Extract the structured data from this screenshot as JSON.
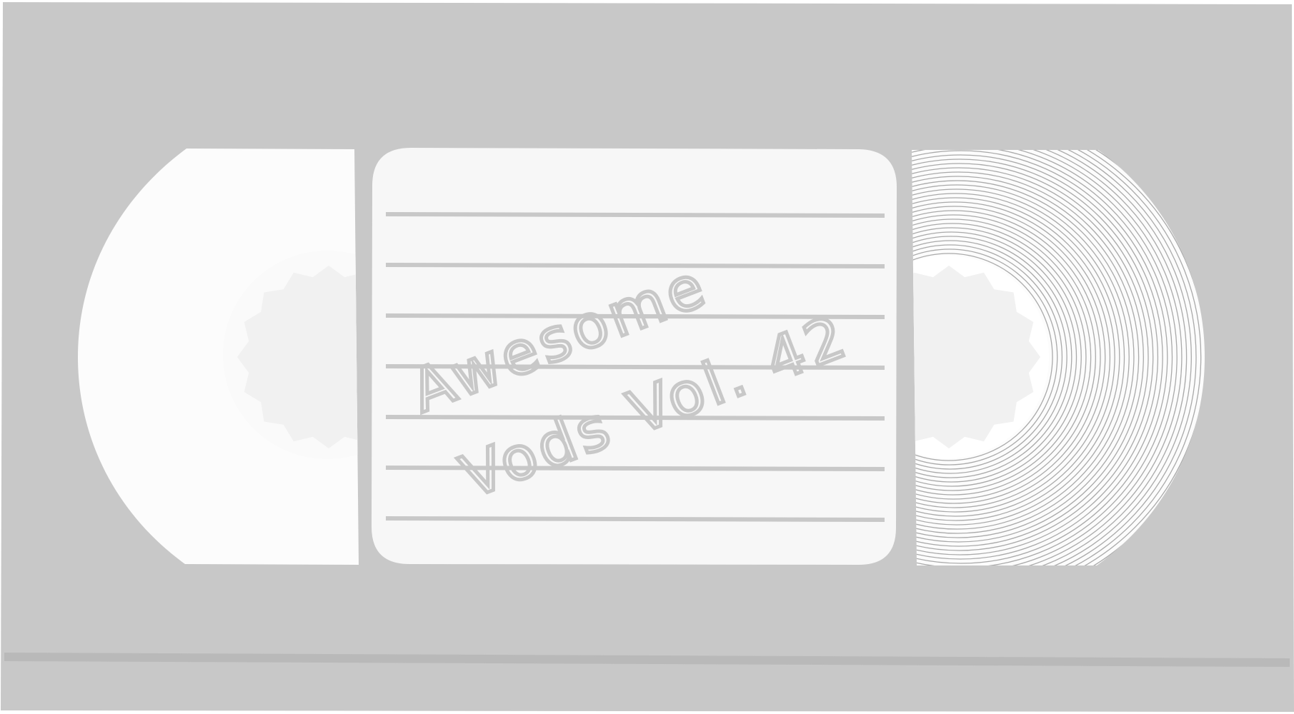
{
  "label": {
    "line1": "Awesome",
    "line2": "Vods Vol. 42"
  },
  "icons": {
    "cassette": "vhs-cassette-icon",
    "left_reel": "left-tape-reel-icon",
    "right_reel": "right-tape-reel-icon"
  },
  "colors": {
    "body": "#c8c8c8",
    "window": "#fcfcfc",
    "label": "#f7f7f7",
    "hub": "#f1f1f1",
    "tape_rings": "#aaaaaa",
    "bottom_line": "#b9b9b9"
  }
}
